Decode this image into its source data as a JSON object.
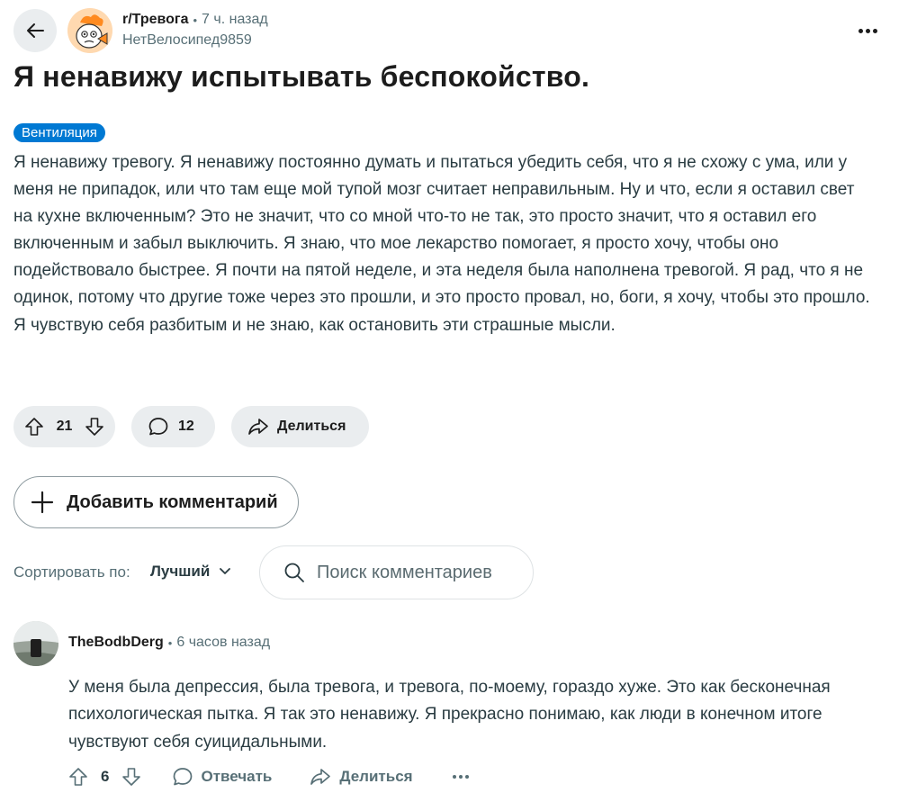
{
  "header": {
    "back_icon": "arrow-left-icon",
    "subreddit": "r/Тревога",
    "time_ago": "7 ч. назад",
    "author": "НетВелосипед9859",
    "more_icon": "ellipsis-icon"
  },
  "post": {
    "title": "Я ненавижу испытывать беспокойство.",
    "flair": "Вентиляция",
    "body": "Я ненавижу тревогу. Я ненавижу постоянно думать и пытаться убедить себя, что я не схожу с ума, или у меня не припадок, или что там еще мой тупой мозг считает неправильным. Ну и что, если я оставил свет на кухне включенным? Это не значит, что со мной что-то не так, это просто значит, что я оставил его включенным и забыл выключить. Я знаю, что мое лекарство помогает, я просто хочу, чтобы оно подействовало быстрее. Я почти на пятой неделе, и эта неделя была наполнена тревогой. Я рад, что я не одинок, потому что другие тоже через это прошли, и это просто провал, но, боги, я хочу, чтобы это прошло. Я чувствую себя разбитым и не знаю, как остановить эти страшные мысли."
  },
  "actions": {
    "score": "21",
    "comments": "12",
    "share_label": "Делиться"
  },
  "add_comment_label": "Добавить комментарий",
  "sort": {
    "label": "Сортировать по:",
    "value": "Лучший"
  },
  "search": {
    "placeholder": "Поиск комментариев"
  },
  "comment": {
    "author": "TheBodbDerg",
    "time_ago": "6 часов назад",
    "body": "У меня была депрессия, была тревога, и тревога, по-моему, гораздо хуже. Это как бесконечная психологическая пытка. Я так это ненавижу. Я прекрасно понимаю, как люди в конечном итоге чувствуют себя суицидальными.",
    "score": "6",
    "reply_label": "Отвечать",
    "share_label": "Делиться"
  },
  "colors": {
    "accent": "#0079d3",
    "pill_bg": "#eaedef",
    "muted_text": "#576f76"
  }
}
